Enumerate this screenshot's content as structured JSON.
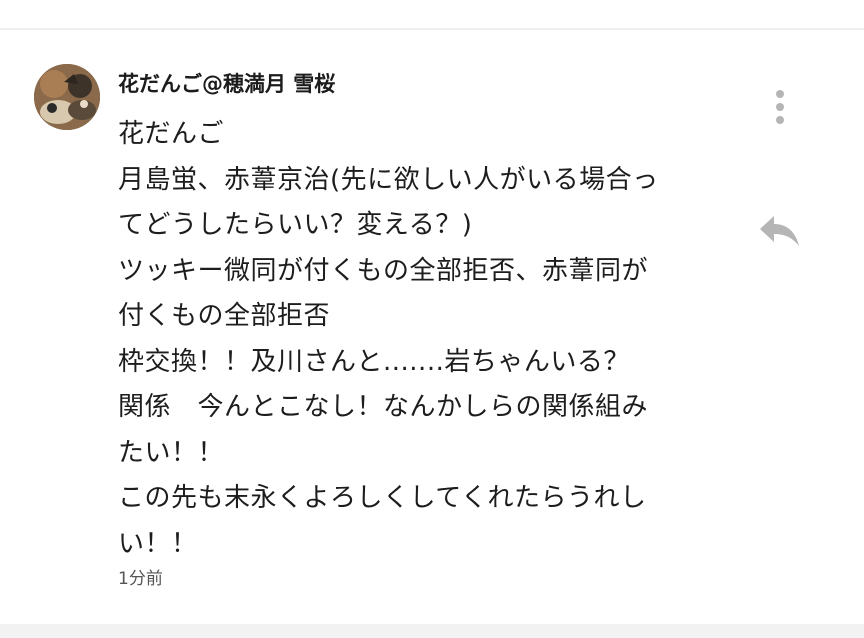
{
  "comment": {
    "author": "花だんご@穂満月 雪桜",
    "lines": [
      "花だんご",
      "月島蛍、赤葦京治(先に欲しい人がいる場合っ",
      "てどうしたらいい？変える？)",
      "ツッキー微同が付くもの全部拒否、赤葦同が",
      "付くもの全部拒否",
      "枠交換！！及川さんと.......岩ちゃんいる？",
      "関係　今んとこなし！なんかしらの関係組み",
      "たい！！",
      "この先も末永くよろしくしてくれたらうれし",
      "い！！"
    ],
    "timestamp": "1分前"
  },
  "icons": {
    "menu": "more-vertical-icon",
    "reply": "reply-arrow-icon",
    "avatar": "user-avatar"
  },
  "colors": {
    "icon_gray": "#b5b5b5",
    "divider": "#efefef",
    "text": "#1d1d1d"
  }
}
